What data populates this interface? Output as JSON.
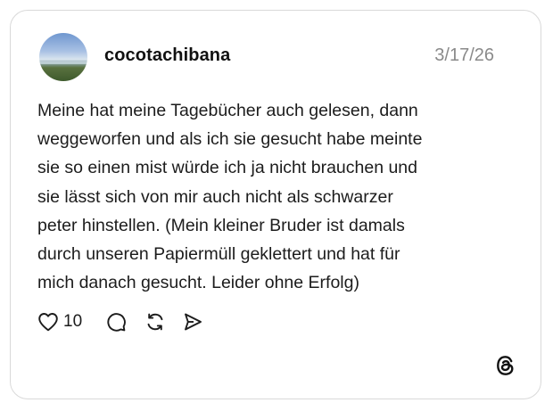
{
  "post": {
    "username": "cocotachibana",
    "date": "3/17/26",
    "text_lines": [
      "Meine hat meine Tagebücher auch gelesen, dann",
      "weggeworfen und als ich sie gesucht habe meinte",
      "sie so einen mist würde ich ja nicht brauchen und",
      "sie lässt sich von mir auch nicht als schwarzer",
      "peter hinstellen. (Mein kleiner Bruder ist damals",
      "durch unseren Papiermüll geklettert und hat für",
      "mich danach gesucht. Leider ohne Erfolg)"
    ],
    "likes": "10"
  },
  "icons": {
    "like": "heart-icon",
    "reply": "comment-bubble-icon",
    "repost": "repost-icon",
    "share": "send-icon",
    "brand": "threads-logo-icon"
  },
  "colors": {
    "card_border": "#d9d9d9",
    "text": "#1c1c1c",
    "date": "#8a8a8a"
  }
}
